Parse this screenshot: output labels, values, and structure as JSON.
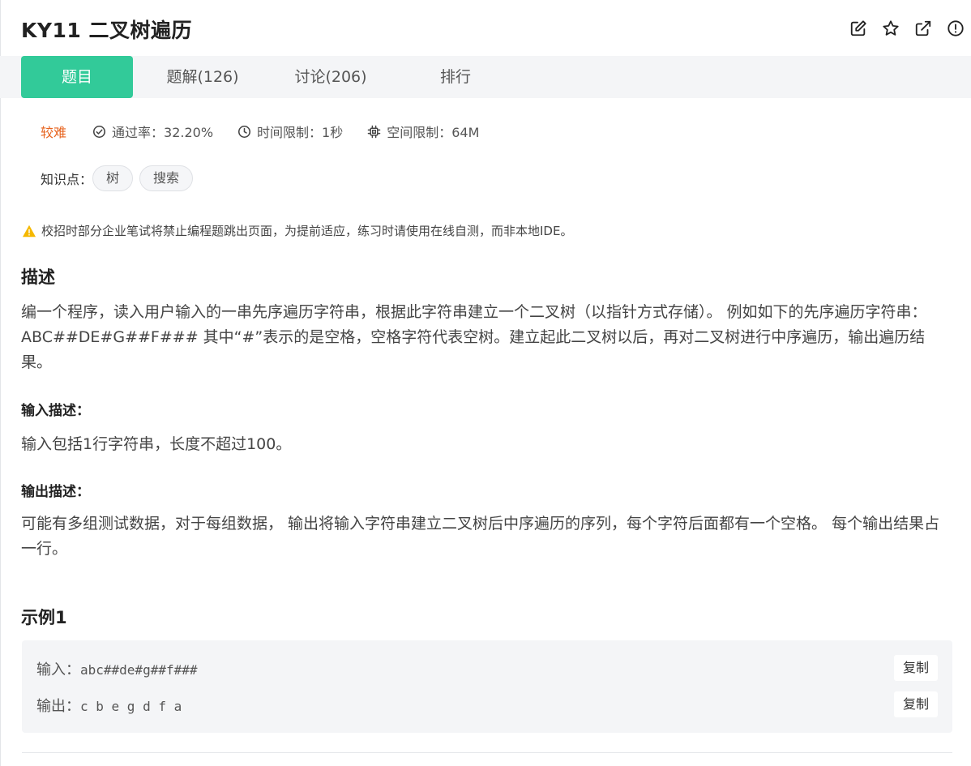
{
  "header": {
    "title": "KY11  二叉树遍历",
    "icons": [
      "edit-icon",
      "star-icon",
      "external-link-icon",
      "info-icon"
    ]
  },
  "tabs": [
    {
      "label": "题目",
      "active": true
    },
    {
      "label": "题解(126)",
      "active": false
    },
    {
      "label": "讨论(206)",
      "active": false
    },
    {
      "label": "排行",
      "active": false
    }
  ],
  "meta": {
    "difficulty": "较难",
    "pass_rate": "通过率：32.20%",
    "time_limit": "时间限制：1秒",
    "space_limit": "空间限制：64M"
  },
  "knowledge": {
    "label": "知识点：",
    "tags": [
      "树",
      "搜索"
    ]
  },
  "notice": "校招时部分企业笔试将禁止编程题跳出页面，为提前适应，练习时请使用在线自测，而非本地IDE。",
  "description": {
    "heading": "描述",
    "text": "编一个程序，读入用户输入的一串先序遍历字符串，根据此字符串建立一个二叉树（以指针方式存储）。 例如如下的先序遍历字符串： ABC##DE#G##F### 其中“#”表示的是空格，空格字符代表空树。建立起此二叉树以后，再对二叉树进行中序遍历，输出遍历结果。"
  },
  "input_desc": {
    "heading": "输入描述：",
    "text": "输入包括1行字符串，长度不超过100。"
  },
  "output_desc": {
    "heading": "输出描述：",
    "text": "可能有多组测试数据，对于每组数据， 输出将输入字符串建立二叉树后中序遍历的序列，每个字符后面都有一个空格。 每个输出结果占一行。"
  },
  "example": {
    "heading": "示例1",
    "input_label": "输入：",
    "input_value": "abc##de#g##f###",
    "output_label": "输出：",
    "output_value": "c b e g d f a",
    "copy_label": "复制"
  },
  "colors": {
    "accent": "#32ca99",
    "difficulty": "#e7641f",
    "warning": "#f5b800"
  }
}
